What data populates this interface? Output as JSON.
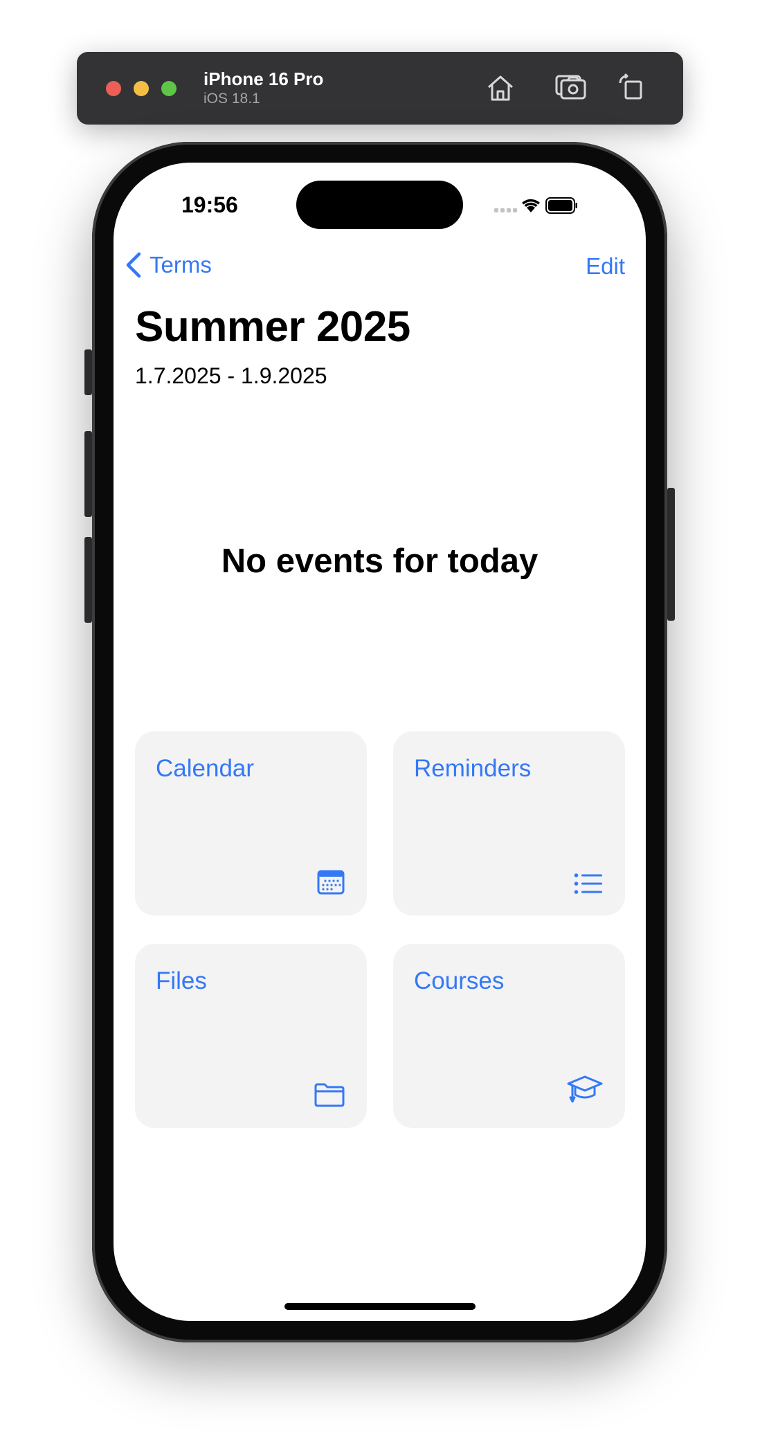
{
  "simulator": {
    "device_name": "iPhone 16 Pro",
    "os_version": "iOS 18.1",
    "icons": [
      "home-icon",
      "screenshot-icon",
      "rotate-icon"
    ]
  },
  "status_bar": {
    "time": "19:56",
    "icons": [
      "signal-icon",
      "wifi-icon",
      "battery-icon"
    ]
  },
  "nav": {
    "back_label": "Terms",
    "edit_label": "Edit"
  },
  "page": {
    "title": "Summer 2025",
    "date_range": "1.7.2025 - 1.9.2025",
    "empty_message": "No events for today"
  },
  "tiles": [
    {
      "label": "Calendar",
      "icon": "calendar-icon"
    },
    {
      "label": "Reminders",
      "icon": "list-icon"
    },
    {
      "label": "Files",
      "icon": "folder-icon"
    },
    {
      "label": "Courses",
      "icon": "graduation-cap-icon"
    }
  ],
  "colors": {
    "accent": "#3478f6",
    "tile_background": "#f3f3f4",
    "toolbar": "#333335"
  }
}
